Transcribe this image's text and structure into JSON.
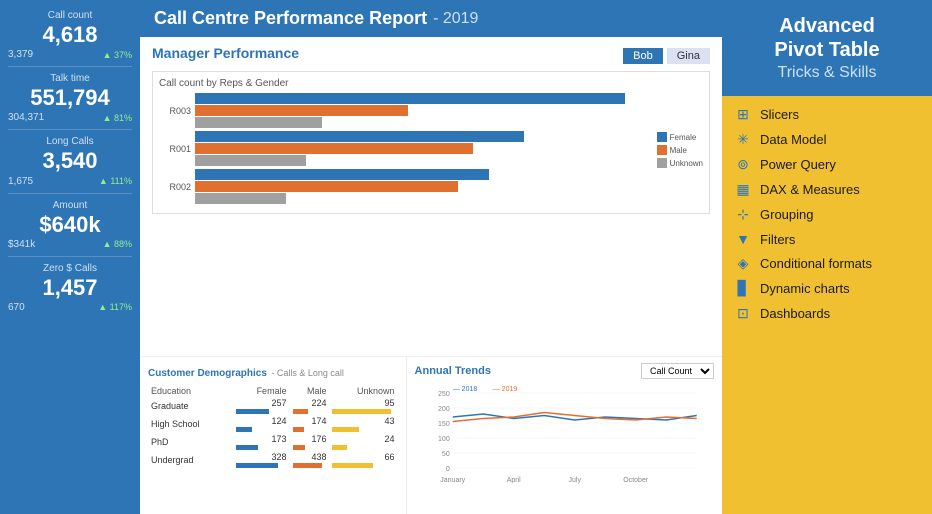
{
  "header": {
    "title": "Call Centre Performance Report",
    "subtitle": "- 2019"
  },
  "metrics": [
    {
      "label": "Call count",
      "value": "4,618",
      "sub1": "3,379",
      "sub2": "37%"
    },
    {
      "label": "Talk time",
      "value": "551,794",
      "sub1": "304,371",
      "sub2": "81%"
    },
    {
      "label": "Long Calls",
      "value": "3,540",
      "sub1": "1,675",
      "sub2": "111%"
    },
    {
      "label": "Amount",
      "value": "$640k",
      "sub1": "$341k",
      "sub2": "88%"
    },
    {
      "label": "Zero $ Calls",
      "value": "1,457",
      "sub1": "670",
      "sub2": "117%"
    }
  ],
  "manager_section": {
    "title": "Manager Performance",
    "buttons": [
      "Bob",
      "Gina"
    ],
    "active_button": "Bob",
    "chart_label": "Call count by Reps & Gender",
    "bars": [
      {
        "label": "R003",
        "female": 85,
        "male": 42,
        "unknown": 25
      },
      {
        "label": "R001",
        "female": 65,
        "male": 55,
        "unknown": 22
      },
      {
        "label": "R002",
        "female": 58,
        "male": 52,
        "unknown": 18
      }
    ],
    "legend": [
      "Female",
      "Male",
      "Unknown"
    ],
    "colors": {
      "female": "#2e75b6",
      "male": "#e07030",
      "unknown": "#a0a0a0"
    }
  },
  "demographics": {
    "title": "Customer Demographics",
    "subtitle": "- Calls & Long call",
    "columns": [
      "Education",
      "Female",
      "Male",
      "Unknown"
    ],
    "rows": [
      {
        "edu": "Graduate",
        "female": 257,
        "male": 224,
        "unknown": 95
      },
      {
        "edu": "High School",
        "female": 124,
        "male": 174,
        "unknown": 43
      },
      {
        "edu": "PhD",
        "female": 173,
        "male": 176,
        "unknown": 24
      },
      {
        "edu": "Undergrad",
        "female": 328,
        "male": 438,
        "unknown": 66
      }
    ]
  },
  "annual_trends": {
    "title": "Annual Trends",
    "dropdown": "Call Count",
    "legend": [
      "2018",
      "2019"
    ],
    "colors": {
      "2018": "#2e75b6",
      "2019": "#e07030"
    },
    "x_labels": [
      "January",
      "April",
      "July",
      "October"
    ],
    "y_labels": [
      "250",
      "200",
      "150",
      "100",
      "50",
      "0"
    ],
    "data_2018": [
      170,
      180,
      165,
      175,
      160,
      170,
      165,
      160,
      175
    ],
    "data_2019": [
      155,
      165,
      170,
      185,
      175,
      165,
      160,
      170,
      165
    ]
  },
  "right_panel": {
    "title": "Advanced\nPivot Table",
    "subtitle": "Tricks & Skills",
    "items": [
      {
        "icon": "⊞",
        "label": "Slicers"
      },
      {
        "icon": "✳",
        "label": "Data Model"
      },
      {
        "icon": "⊚",
        "label": "Power Query"
      },
      {
        "icon": "▦",
        "label": "DAX & Measures"
      },
      {
        "icon": "⊹",
        "label": "Grouping"
      },
      {
        "icon": "▼",
        "label": "Filters"
      },
      {
        "icon": "◈",
        "label": "Conditional formats"
      },
      {
        "icon": "▊",
        "label": "Dynamic charts"
      },
      {
        "icon": "⊡",
        "label": "Dashboards"
      }
    ]
  }
}
